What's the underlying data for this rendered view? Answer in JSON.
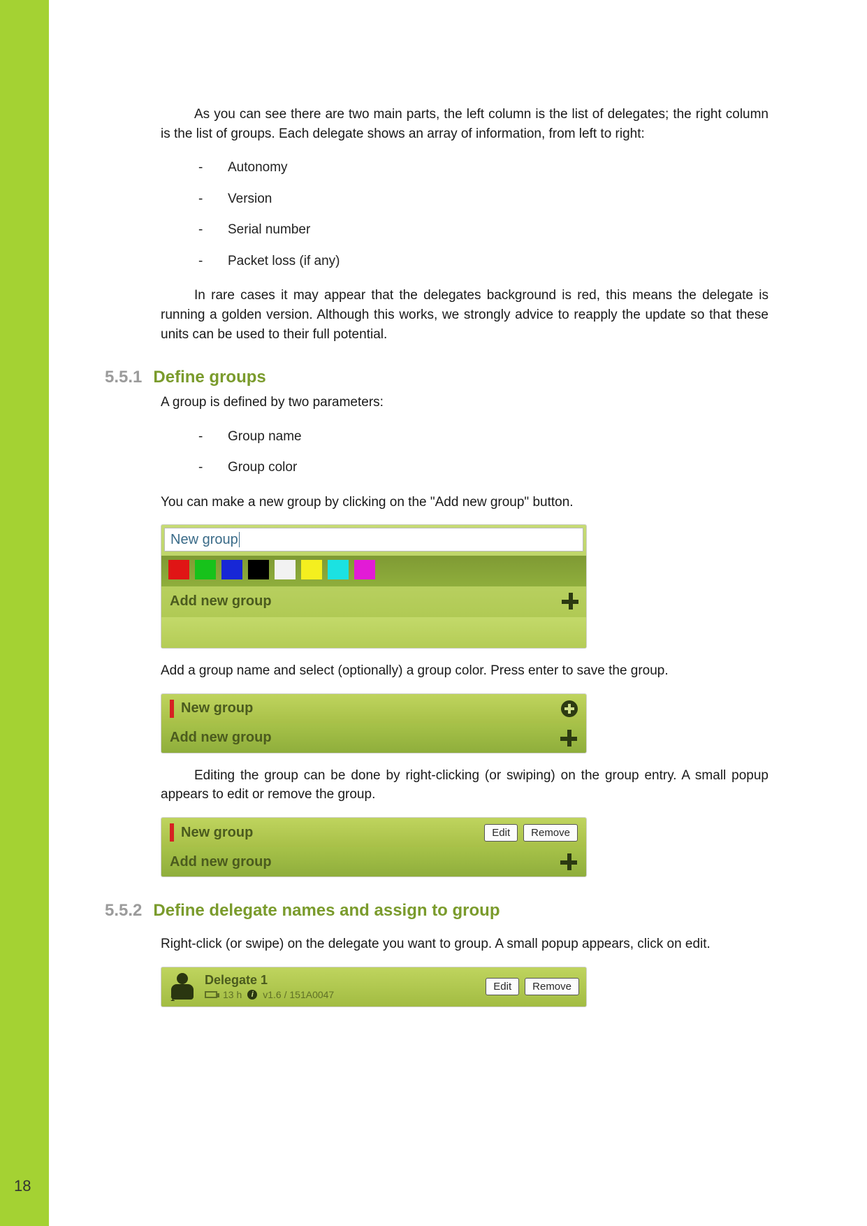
{
  "page_number": "18",
  "intro_para1": "As you can see there are two main parts, the left column is the list of delegates; the right column is the list of groups. Each delegate shows an array of information, from left to right:",
  "intro_list": [
    "Autonomy",
    "Version",
    "Serial number",
    "Packet loss (if any)"
  ],
  "intro_para2": "In rare cases it may appear that the delegates background is red, this means the delegate is running a golden version. Although this works, we strongly advice to reapply the update so that these units can be used to their full potential.",
  "sec551_num": "5.5.1",
  "sec551_title": "Define groups",
  "sec551_p1": "A group is defined by two parameters:",
  "sec551_list": [
    "Group name",
    "Group color"
  ],
  "sec551_p2": "You can make a new group by clicking on the \"Add new group\" button.",
  "fig1_input_value": "New group",
  "add_new_group_label": "Add new group",
  "sec551_p3": "Add a group name and select (optionally) a group color. Press enter to save the group.",
  "fig2_newgroup_label": "New group",
  "sec551_p4": "Editing the group can be done by right-clicking (or swiping) on the group entry. A small popup appears to edit or remove the group.",
  "fig3_newgroup_label": "New group",
  "edit_btn": "Edit",
  "remove_btn": "Remove",
  "sec552_num": "5.5.2",
  "sec552_title": "Define delegate names and assign to group",
  "sec552_p1": "Right-click (or swipe) on the delegate you want to group. A small popup appears, click on edit.",
  "delegate": {
    "name": "Delegate 1",
    "battery": "13 h",
    "version_serial": "v1.6 / 151A0047"
  },
  "palette_colors": [
    "red",
    "green",
    "blue",
    "black",
    "white",
    "yellow",
    "cyan",
    "magenta"
  ]
}
